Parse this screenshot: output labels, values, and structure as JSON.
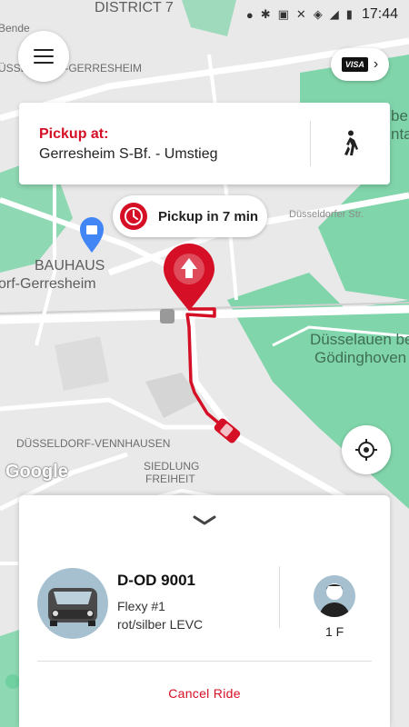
{
  "status_bar": {
    "time": "17:44",
    "icons": [
      "location-icon",
      "bluetooth-icon",
      "nfc-icon",
      "mute-icon",
      "wifi-icon",
      "signal-icon",
      "battery-icon"
    ]
  },
  "map": {
    "labels": {
      "district": "DISTRICT 7",
      "gerresheim": "ÜSSELDORF-GERRESHEIM",
      "bauhaus": "BAUHAUS",
      "bauhaus_sub": "orf-Gerresheim",
      "duesselauen": "Düsselauen be",
      "goedinghoven": "Gödinghoven",
      "vennhausen": "DÜSSELDORF-VENNHAUSEN",
      "siedlung": "SIEDLUNG",
      "freiheit": "FREIHEIT",
      "duesseldorfer_str": "Düsseldorfer Str.",
      "benden": "Bende",
      "top_right_a": "ber",
      "top_right_b": "ntal",
      "google": "Google"
    },
    "colors": {
      "background": "#e9e9e9",
      "park": "#6fd1a0",
      "road": "#ffffff",
      "route": "#d50f25"
    }
  },
  "header": {
    "menu_icon": "hamburger-menu-icon",
    "payment": {
      "card_brand": "VISA",
      "chevron": "chevron-right-icon"
    }
  },
  "pickup": {
    "label": "Pickup at:",
    "address": "Gerresheim S-Bf. - Umstieg",
    "walk_icon": "walking-person-icon"
  },
  "eta": {
    "text": "Pickup in 7 min",
    "icon": "clock-icon"
  },
  "vehicle": {
    "plate": "D-OD 9001",
    "name": "Flexy #1",
    "description": "rot/silber LEVC"
  },
  "driver": {
    "label": "1 F"
  },
  "actions": {
    "cancel_label": "Cancel Ride"
  },
  "accent_color": "#d50f25"
}
